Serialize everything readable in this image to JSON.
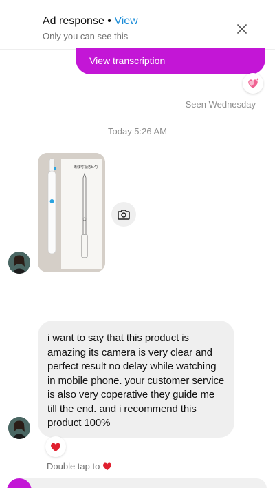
{
  "header": {
    "title": "Ad response",
    "separator": " • ",
    "view_link": "View",
    "subtitle": "Only you can see this",
    "close_icon": "close-icon"
  },
  "messages": {
    "outgoing_button": "View transcription",
    "outgoing_reaction": "sparkling-heart-icon",
    "seen_status": "Seen Wednesday",
    "timestamp": "Today 5:26 AM",
    "photo_caption": "无线可视洁耳勺",
    "camera_icon": "camera-icon",
    "incoming_text": "i want to say that this product is amazing its camera is very clear and perfect result no delay while watching in mobile phone. your customer service is also very coperative they guide me till the end. and i recommend this product 100%",
    "incoming_reaction": "red-heart-icon",
    "double_tap_hint": "Double tap to"
  },
  "colors": {
    "accent_purple": "#c316d6",
    "link_blue": "#1a8cd8",
    "bubble_gray": "#efefef",
    "heart_red": "#e0202f",
    "meta_gray": "#8e8e8e"
  }
}
